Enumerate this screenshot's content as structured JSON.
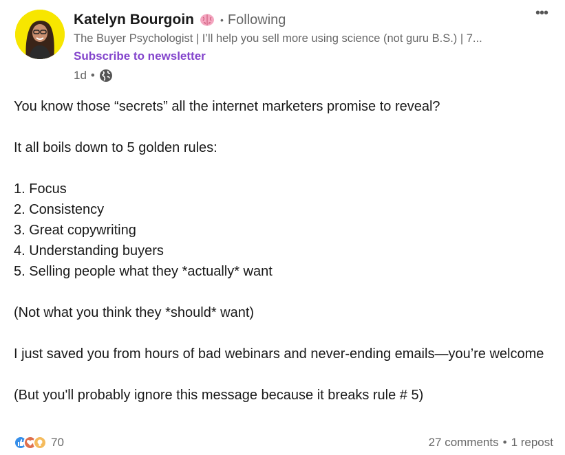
{
  "author": {
    "name": "Katelyn Bourgoin",
    "emoji": "brain-icon",
    "follow_status": "Following",
    "separator": "•",
    "headline": "The Buyer Psychologist | I’ll help you sell more using science (not guru B.S.) | 7...",
    "subscribe_label": "Subscribe to newsletter",
    "timestamp": "1d",
    "visibility_icon": "globe-icon"
  },
  "menu": {
    "more_label": "•••"
  },
  "post": {
    "paragraphs": [
      "You know those “secrets” all the internet marketers promise to reveal?",
      "",
      "It all boils down to 5 golden rules:",
      "",
      "1. Focus",
      "2. Consistency",
      "3. Great copywriting",
      "4. Understanding buyers",
      "5. Selling people what they *actually* want",
      "",
      "(Not what you think they *should* want)",
      "",
      "I just saved you from hours of bad webinars and never-ending emails—you’re welcome",
      "",
      "(But you'll probably ignore this message because it breaks rule # 5)"
    ]
  },
  "footer": {
    "reaction_icons": [
      "like-icon",
      "love-icon",
      "insightful-icon"
    ],
    "reaction_count": "70",
    "comments": "27 comments",
    "separator": "•",
    "reposts": "1 repost"
  },
  "colors": {
    "accent_purple": "#8344cc",
    "muted_text": "#666666",
    "avatar_bg": "#f7e600",
    "like_blue": "#378fe9",
    "love_red": "#df704d",
    "insightful_yellow": "#f5bb5c"
  }
}
